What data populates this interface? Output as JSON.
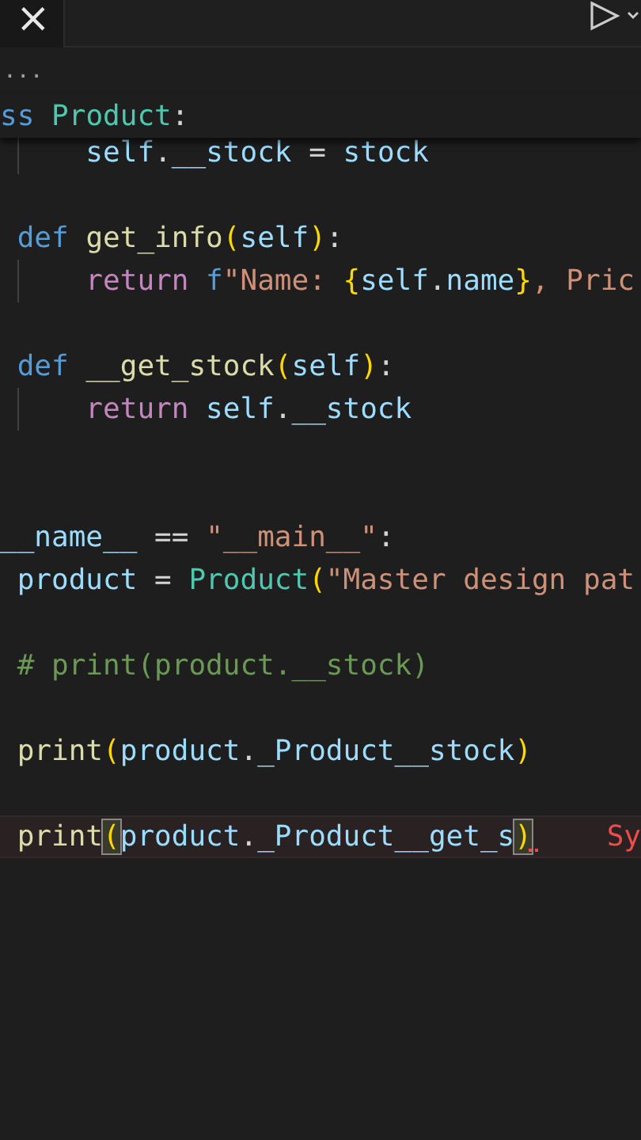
{
  "title_bar": {
    "close": "×"
  },
  "breadcrumb": "...",
  "sticky_line": [
    {
      "kind": "keyword",
      "text": "ss "
    },
    {
      "kind": "class",
      "text": "Product"
    },
    {
      "kind": "plain",
      "text": ":"
    }
  ],
  "lines": [
    {
      "kind": "code",
      "guide": true,
      "current": false,
      "tokens": [
        {
          "kind": "variable",
          "text": "     self"
        },
        {
          "kind": "plain",
          "text": "."
        },
        {
          "kind": "variable",
          "text": "__stock"
        },
        {
          "kind": "plain",
          "text": " = "
        },
        {
          "kind": "variable",
          "text": "stock"
        }
      ]
    },
    {
      "kind": "blank"
    },
    {
      "kind": "code",
      "guide": false,
      "current": false,
      "tokens": [
        {
          "kind": "keyword",
          "text": " def "
        },
        {
          "kind": "function",
          "text": "get_info"
        },
        {
          "kind": "paren",
          "text": "("
        },
        {
          "kind": "variable",
          "text": "self"
        },
        {
          "kind": "paren",
          "text": ")"
        },
        {
          "kind": "plain",
          "text": ":"
        }
      ]
    },
    {
      "kind": "code",
      "guide": true,
      "current": false,
      "tokens": [
        {
          "kind": "control",
          "text": "     return "
        },
        {
          "kind": "keyword",
          "text": "f"
        },
        {
          "kind": "string",
          "text": "\"Name: "
        },
        {
          "kind": "paren",
          "text": "{"
        },
        {
          "kind": "variable",
          "text": "self"
        },
        {
          "kind": "plain",
          "text": "."
        },
        {
          "kind": "variable",
          "text": "name"
        },
        {
          "kind": "paren",
          "text": "}"
        },
        {
          "kind": "string",
          "text": ", Pric"
        }
      ]
    },
    {
      "kind": "blank"
    },
    {
      "kind": "code",
      "guide": false,
      "current": false,
      "tokens": [
        {
          "kind": "keyword",
          "text": " def "
        },
        {
          "kind": "function",
          "text": "__get_stock"
        },
        {
          "kind": "paren",
          "text": "("
        },
        {
          "kind": "variable",
          "text": "self"
        },
        {
          "kind": "paren",
          "text": ")"
        },
        {
          "kind": "plain",
          "text": ":"
        }
      ]
    },
    {
      "kind": "code",
      "guide": true,
      "current": false,
      "tokens": [
        {
          "kind": "control",
          "text": "     return "
        },
        {
          "kind": "variable",
          "text": "self"
        },
        {
          "kind": "plain",
          "text": "."
        },
        {
          "kind": "variable",
          "text": "__stock"
        }
      ]
    },
    {
      "kind": "blank"
    },
    {
      "kind": "blank"
    },
    {
      "kind": "code",
      "guide": false,
      "current": false,
      "tokens": [
        {
          "kind": "variable",
          "text": "__name__"
        },
        {
          "kind": "plain",
          "text": " == "
        },
        {
          "kind": "string",
          "text": "\"__main__\""
        },
        {
          "kind": "plain",
          "text": ":"
        }
      ]
    },
    {
      "kind": "code",
      "guide": false,
      "current": false,
      "tokens": [
        {
          "kind": "variable",
          "text": " product"
        },
        {
          "kind": "plain",
          "text": " = "
        },
        {
          "kind": "class",
          "text": "Product"
        },
        {
          "kind": "paren",
          "text": "("
        },
        {
          "kind": "string",
          "text": "\"Master design pat"
        }
      ]
    },
    {
      "kind": "blank"
    },
    {
      "kind": "code",
      "guide": false,
      "current": false,
      "tokens": [
        {
          "kind": "comment",
          "text": " # print(product.__stock)"
        }
      ]
    },
    {
      "kind": "blank"
    },
    {
      "kind": "code",
      "guide": false,
      "current": false,
      "tokens": [
        {
          "kind": "function",
          "text": " print"
        },
        {
          "kind": "paren",
          "text": "("
        },
        {
          "kind": "variable",
          "text": "product"
        },
        {
          "kind": "plain",
          "text": "."
        },
        {
          "kind": "variable",
          "text": "_Product__stock"
        },
        {
          "kind": "paren",
          "text": ")"
        }
      ]
    },
    {
      "kind": "blank"
    },
    {
      "kind": "code",
      "guide": false,
      "current": true,
      "error": "Sy",
      "tokens": [
        {
          "kind": "function",
          "text": " print"
        },
        {
          "kind": "match",
          "text": "("
        },
        {
          "kind": "variable",
          "text": "product"
        },
        {
          "kind": "plain",
          "text": "."
        },
        {
          "kind": "variable",
          "text": "_Product__get_s"
        },
        {
          "kind": "match",
          "text": ")"
        }
      ]
    }
  ]
}
